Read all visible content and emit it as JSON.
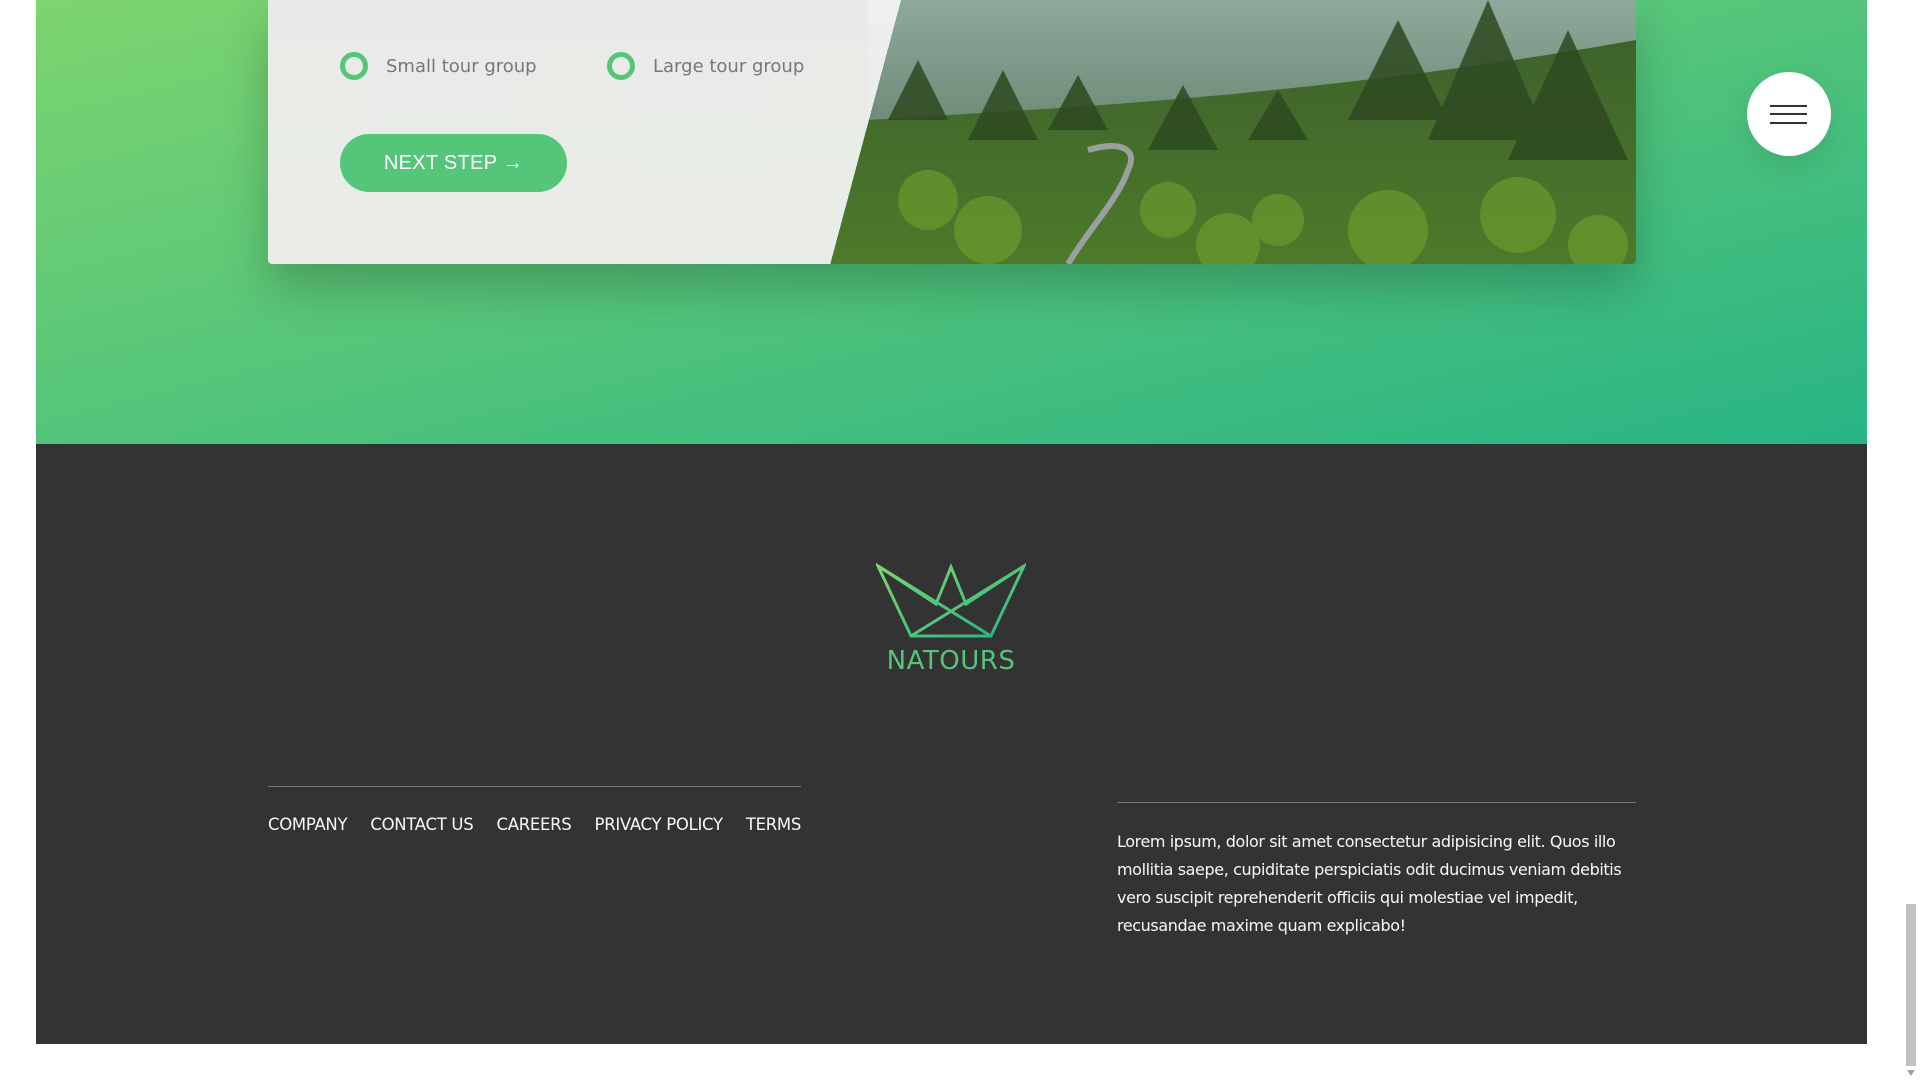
{
  "booking": {
    "radio_options": [
      {
        "label": "Small tour group"
      },
      {
        "label": "Large tour group"
      }
    ],
    "next_button_label": "NEXT STEP →"
  },
  "navigation": {
    "menu_icon": "hamburger-menu-icon"
  },
  "footer": {
    "logo_text": "NATOURS",
    "logo_icon": "crown-logo-icon",
    "nav_links": [
      "COMPANY",
      "CONTACT US",
      "CAREERS",
      "PRIVACY POLICY",
      "TERMS"
    ],
    "copyright_text": "Lorem ipsum, dolor sit amet consectetur adipisicing elit. Quos illo mollitia saepe, cupiditate perspiciatis odit ducimus veniam debitis vero suscipit reprehenderit officiis qui molestiae vel impedit, recusandae maxime quam explicabo!"
  },
  "colors": {
    "primary": "#55c57a",
    "gradient_light": "#7ed56f",
    "gradient_dark": "#28b485",
    "footer_bg": "#333333",
    "footer_text": "#f7f7f7"
  }
}
